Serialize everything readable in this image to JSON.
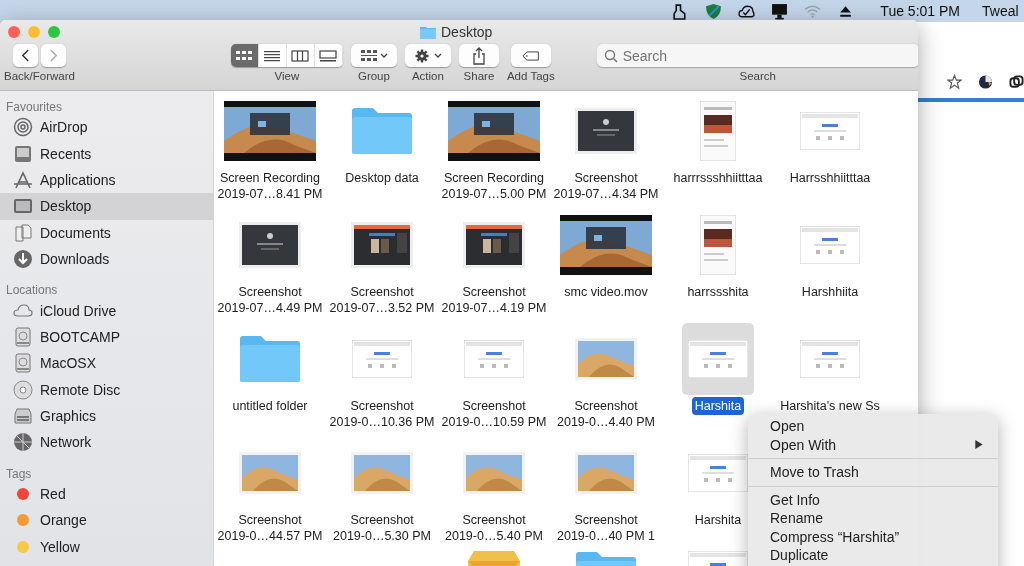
{
  "menu_bar": {
    "clock": "Tue 5:01 PM",
    "app_label": "Tweal"
  },
  "window": {
    "title": "Desktop"
  },
  "toolbar": {
    "back_forward_label": "Back/Forward",
    "view_label": "View",
    "view_modes": [
      {
        "kind": "icons",
        "selected": true
      },
      {
        "kind": "list",
        "selected": false
      },
      {
        "kind": "columns",
        "selected": false
      },
      {
        "kind": "gallery",
        "selected": false
      }
    ],
    "tools": [
      {
        "kind": "group",
        "label": "Group"
      },
      {
        "kind": "action",
        "label": "Action"
      },
      {
        "kind": "share",
        "label": "Share"
      },
      {
        "kind": "tags",
        "label": "Add Tags"
      }
    ],
    "search": {
      "placeholder": "Search",
      "label": "Search"
    }
  },
  "sidebar": {
    "sections": [
      {
        "title": "Favourites",
        "items": [
          {
            "label": "AirDrop",
            "kind": "airdrop",
            "selected": false
          },
          {
            "label": "Recents",
            "kind": "recents",
            "selected": false
          },
          {
            "label": "Applications",
            "kind": "applications",
            "selected": false
          },
          {
            "label": "Desktop",
            "kind": "desktop",
            "selected": true
          },
          {
            "label": "Documents",
            "kind": "documents",
            "selected": false
          },
          {
            "label": "Downloads",
            "kind": "downloads",
            "selected": false
          }
        ]
      },
      {
        "title": "Locations",
        "items": [
          {
            "label": "iCloud Drive",
            "kind": "cloud",
            "selected": false
          },
          {
            "label": "BOOTCAMP",
            "kind": "disk",
            "selected": false
          },
          {
            "label": "MacOSX",
            "kind": "disk",
            "selected": false
          },
          {
            "label": "Remote Disc",
            "kind": "disc",
            "selected": false
          },
          {
            "label": "Graphics",
            "kind": "drive",
            "selected": false
          },
          {
            "label": "Network",
            "kind": "network",
            "selected": false
          }
        ]
      },
      {
        "title": "Tags",
        "items": [
          {
            "label": "Red",
            "kind": "tag",
            "color": "#f0453a",
            "selected": false
          },
          {
            "label": "Orange",
            "kind": "tag",
            "color": "#f39a37",
            "selected": false
          },
          {
            "label": "Yellow",
            "kind": "tag",
            "color": "#f7c945",
            "selected": false
          }
        ]
      }
    ]
  },
  "files": {
    "rows": [
      [
        {
          "kind": "recording",
          "lines": [
            "Screen Recording",
            "2019-07…8.41 PM"
          ],
          "selected": false
        },
        {
          "kind": "folder",
          "lines": [
            "Desktop data"
          ],
          "selected": false
        },
        {
          "kind": "recording",
          "lines": [
            "Screen Recording",
            "2019-07…5.00 PM"
          ],
          "selected": false
        },
        {
          "kind": "dark",
          "lines": [
            "Screenshot",
            "2019-07…4.34 PM"
          ],
          "selected": false
        },
        {
          "kind": "portrait",
          "lines": [
            "harrrssshhiitttaa"
          ],
          "selected": false
        },
        {
          "kind": "web",
          "lines": [
            "Harrsshhiitttaa"
          ],
          "selected": false
        }
      ],
      [
        {
          "kind": "dark",
          "lines": [
            "Screenshot",
            "2019-07…4.49 PM"
          ],
          "selected": false
        },
        {
          "kind": "app",
          "lines": [
            "Screenshot",
            "2019-07…3.52 PM"
          ],
          "selected": false
        },
        {
          "kind": "app",
          "lines": [
            "Screenshot",
            "2019-07…4.19 PM"
          ],
          "selected": false
        },
        {
          "kind": "recording",
          "lines": [
            "smc video.mov"
          ],
          "selected": false
        },
        {
          "kind": "portrait",
          "lines": [
            "harrssshita"
          ],
          "selected": false
        },
        {
          "kind": "web",
          "lines": [
            "Harshhiita"
          ],
          "selected": false
        }
      ],
      [
        {
          "kind": "folder",
          "lines": [
            "untitled folder"
          ],
          "selected": false
        },
        {
          "kind": "web",
          "lines": [
            "Screenshot",
            "2019-0…10.36 PM"
          ],
          "selected": false
        },
        {
          "kind": "web",
          "lines": [
            "Screenshot",
            "2019-0…10.59 PM"
          ],
          "selected": false
        },
        {
          "kind": "desert",
          "lines": [
            "Screenshot",
            "2019-0…4.40 PM"
          ],
          "selected": false
        },
        {
          "kind": "web",
          "lines": [
            "Harshita"
          ],
          "selected": true
        },
        {
          "kind": "web",
          "lines": [
            "Harshita's new Ss"
          ],
          "selected": false
        }
      ],
      [
        {
          "kind": "desert",
          "lines": [
            "Screenshot",
            "2019-0…44.57 PM"
          ],
          "selected": false
        },
        {
          "kind": "desert",
          "lines": [
            "Screenshot",
            "2019-0…5.30 PM"
          ],
          "selected": false
        },
        {
          "kind": "desert",
          "lines": [
            "Screenshot",
            "2019-0…5.40 PM"
          ],
          "selected": false
        },
        {
          "kind": "desert",
          "lines": [
            "Screenshot",
            "2019-0…40 PM 1"
          ],
          "selected": false
        },
        {
          "kind": "web",
          "lines": [
            "Harshita"
          ],
          "selected": false
        }
      ],
      [
        {
          "kind": "package",
          "selected": false
        },
        {
          "kind": "folder",
          "selected": false
        },
        {
          "kind": "web",
          "selected": false
        }
      ]
    ]
  },
  "context_menu": {
    "groups": [
      [
        {
          "label": "Open",
          "has_submenu": false
        },
        {
          "label": "Open With",
          "has_submenu": true
        }
      ],
      [
        {
          "label": "Move to Trash",
          "has_submenu": false
        }
      ],
      [
        {
          "label": "Get Info",
          "has_submenu": false
        },
        {
          "label": "Rename",
          "has_submenu": false
        },
        {
          "label": "Compress “Harshita”",
          "has_submenu": false
        },
        {
          "label": "Duplicate",
          "has_submenu": false
        }
      ]
    ]
  }
}
